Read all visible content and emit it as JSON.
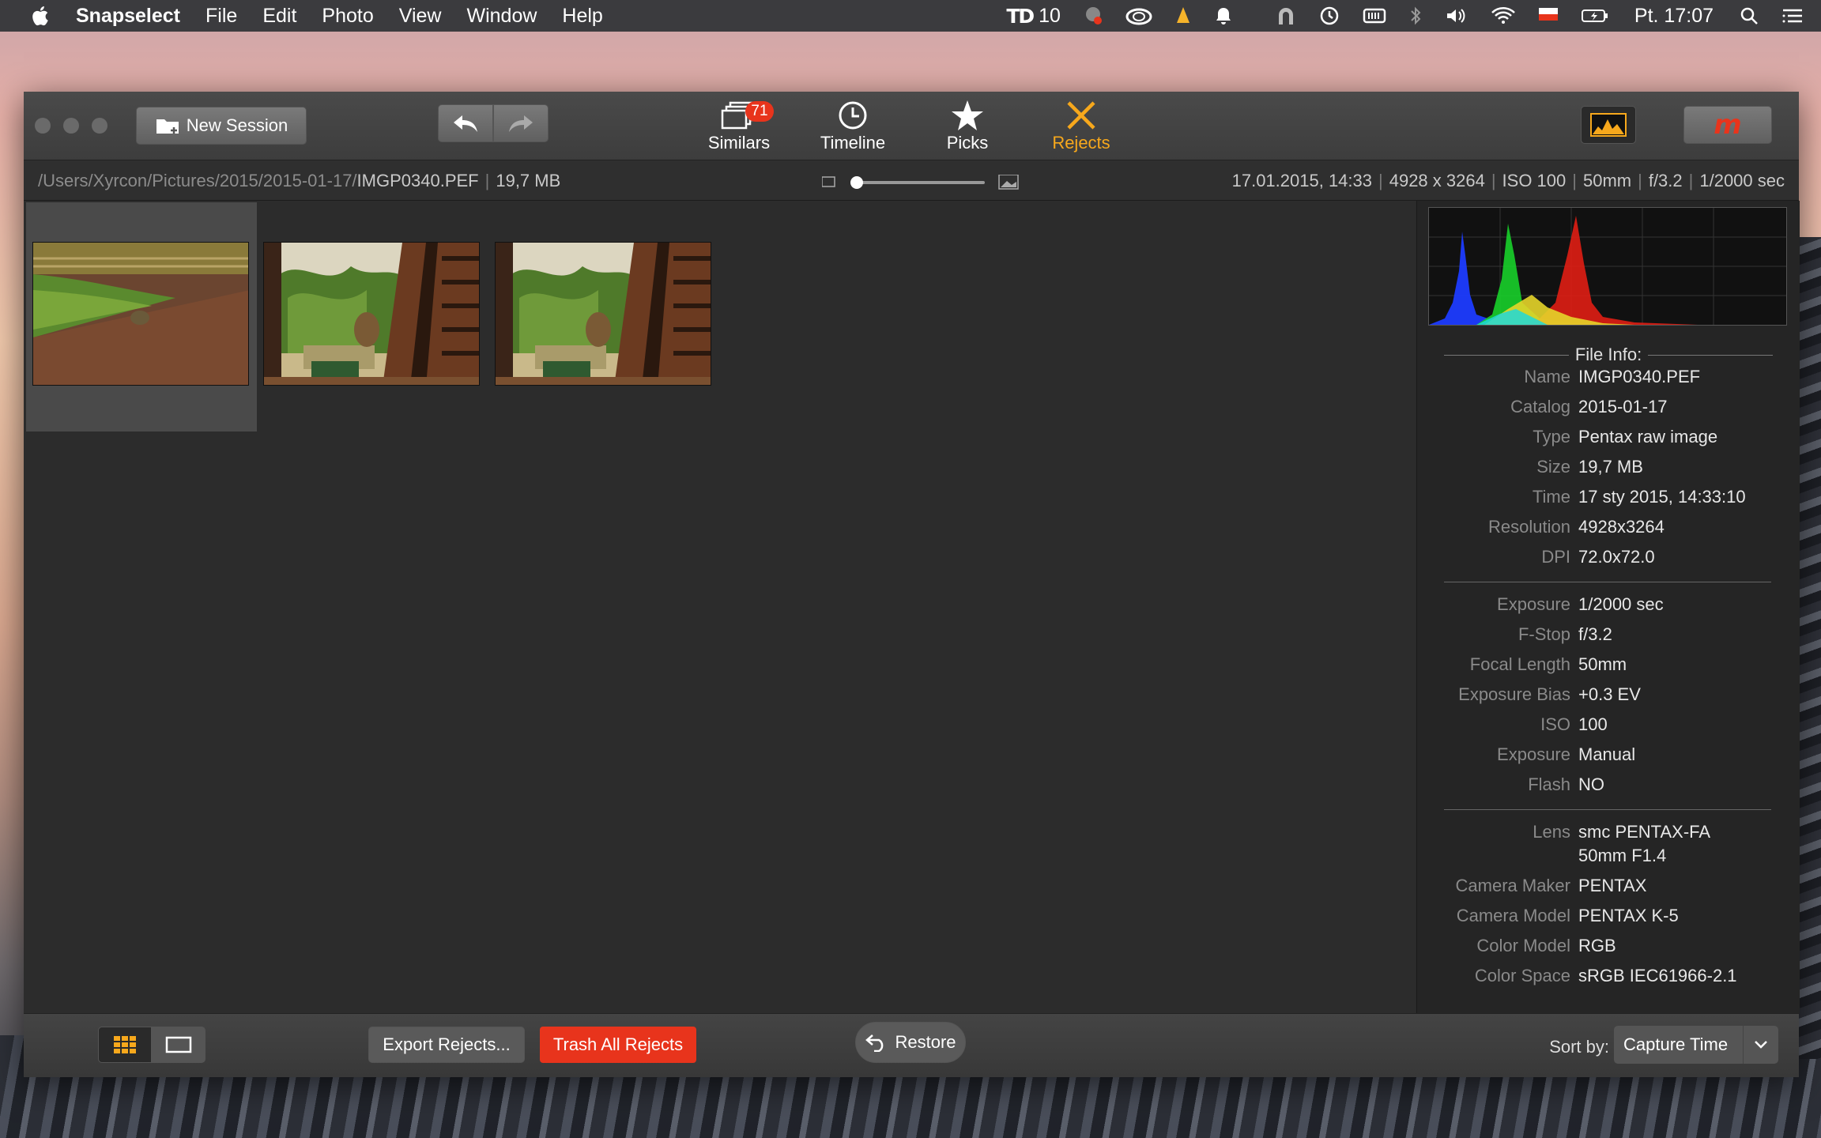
{
  "menubar": {
    "app_name": "Snapselect",
    "items": [
      "File",
      "Edit",
      "Photo",
      "View",
      "Window",
      "Help"
    ],
    "td_label": "10",
    "clock": "Pt. 17:07"
  },
  "toolbar": {
    "new_session": "New Session",
    "tabs": [
      {
        "label": "Similars",
        "badge": "71"
      },
      {
        "label": "Timeline"
      },
      {
        "label": "Picks"
      },
      {
        "label": "Rejects",
        "active": true
      }
    ],
    "accent_color": "#f7a81c"
  },
  "infobar": {
    "path_prefix": "/Users/Xyrcon/Pictures/2015/2015-01-17/",
    "filename": "IMGP0340.PEF",
    "size": "19,7 MB",
    "date": "17.01.2015, 14:33",
    "resolution": "4928 x 3264",
    "iso": "ISO 100",
    "focal": "50mm",
    "fstop": "f/3.2",
    "shutter": "1/2000 sec",
    "zoom_fraction": 0.0
  },
  "thumbnails": [
    {
      "name": "thumb-1",
      "selected": true
    },
    {
      "name": "thumb-2",
      "selected": false
    },
    {
      "name": "thumb-3",
      "selected": false
    }
  ],
  "file_info": {
    "title": "File Info:",
    "group1": [
      {
        "k": "Name",
        "v": "IMGP0340.PEF"
      },
      {
        "k": "Catalog",
        "v": "2015-01-17"
      },
      {
        "k": "Type",
        "v": "Pentax raw image"
      },
      {
        "k": "Size",
        "v": "19,7 MB"
      },
      {
        "k": "Time",
        "v": "17 sty 2015, 14:33:10"
      },
      {
        "k": "Resolution",
        "v": "4928x3264"
      },
      {
        "k": "DPI",
        "v": "72.0x72.0"
      }
    ],
    "group2": [
      {
        "k": "Exposure",
        "v": "1/2000 sec"
      },
      {
        "k": "F-Stop",
        "v": "f/3.2"
      },
      {
        "k": "Focal Length",
        "v": "50mm"
      },
      {
        "k": "Exposure Bias",
        "v": "+0.3 EV"
      },
      {
        "k": "ISO",
        "v": "100"
      },
      {
        "k": "Exposure",
        "v": "Manual"
      },
      {
        "k": "Flash",
        "v": "NO"
      }
    ],
    "group3": [
      {
        "k": "Lens",
        "v": "smc PENTAX-FA",
        "v2": "50mm F1.4"
      },
      {
        "k": "Camera Maker",
        "v": "PENTAX"
      },
      {
        "k": "Camera Model",
        "v": "PENTAX K-5"
      },
      {
        "k": "Color Model",
        "v": "RGB"
      },
      {
        "k": "Color Space",
        "v": "sRGB IEC61966-2.1"
      }
    ]
  },
  "bottombar": {
    "export_rejects": "Export Rejects...",
    "trash_all": "Trash All Rejects",
    "restore": "Restore",
    "sort_label": "Sort by:",
    "sort_value": "Capture Time"
  }
}
